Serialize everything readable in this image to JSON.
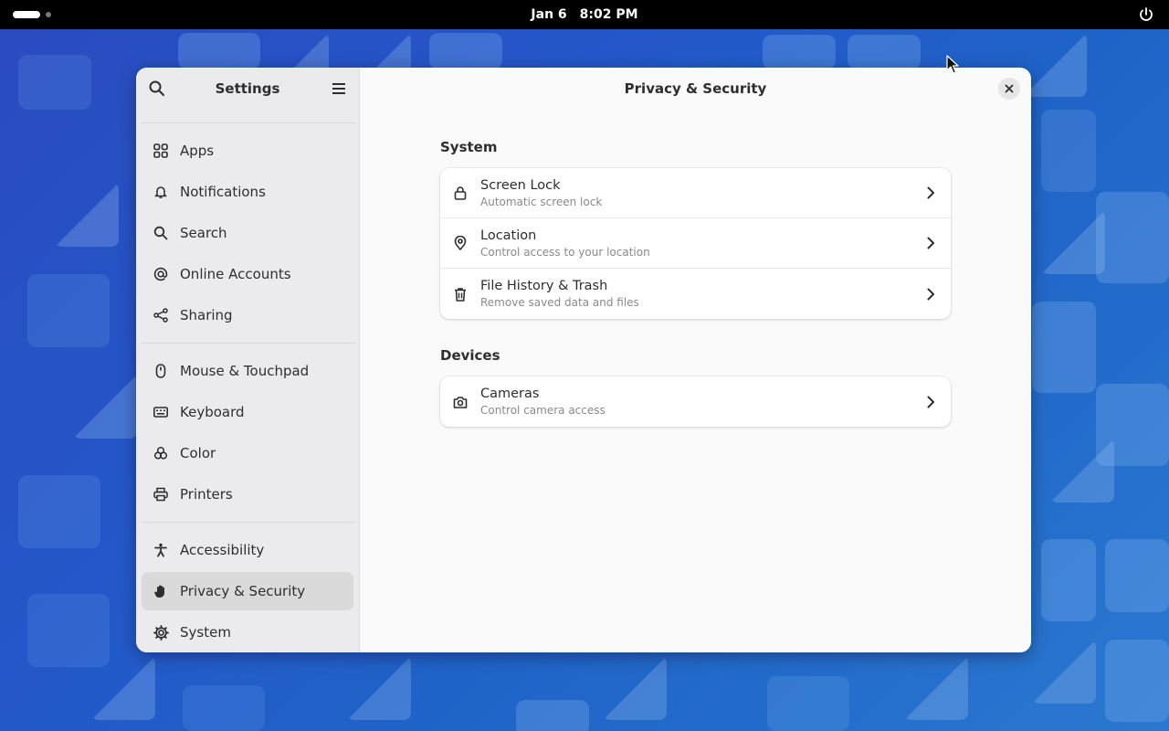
{
  "topbar": {
    "date": "Jan 6",
    "time": "8:02 PM"
  },
  "window": {
    "title": "Settings",
    "page_title": "Privacy & Security"
  },
  "sidebar": {
    "groups": [
      [
        {
          "label": "Apps",
          "icon": "apps-grid-icon"
        },
        {
          "label": "Notifications",
          "icon": "bell-icon"
        },
        {
          "label": "Search",
          "icon": "search-icon"
        },
        {
          "label": "Online Accounts",
          "icon": "at-sign-icon"
        },
        {
          "label": "Sharing",
          "icon": "share-icon"
        }
      ],
      [
        {
          "label": "Mouse & Touchpad",
          "icon": "mouse-icon"
        },
        {
          "label": "Keyboard",
          "icon": "keyboard-icon"
        },
        {
          "label": "Color",
          "icon": "color-icon"
        },
        {
          "label": "Printers",
          "icon": "printer-icon"
        }
      ],
      [
        {
          "label": "Accessibility",
          "icon": "accessibility-icon"
        },
        {
          "label": "Privacy & Security",
          "icon": "hand-icon",
          "active": true
        },
        {
          "label": "System",
          "icon": "gear-icon"
        }
      ]
    ]
  },
  "sections": [
    {
      "title": "System",
      "rows": [
        {
          "title": "Screen Lock",
          "subtitle": "Automatic screen lock",
          "icon": "lock-icon"
        },
        {
          "title": "Location",
          "subtitle": "Control access to your location",
          "icon": "location-pin-icon"
        },
        {
          "title": "File History & Trash",
          "subtitle": "Remove saved data and files",
          "icon": "trash-icon"
        }
      ]
    },
    {
      "title": "Devices",
      "rows": [
        {
          "title": "Cameras",
          "subtitle": "Control camera access",
          "icon": "camera-icon"
        }
      ]
    }
  ]
}
